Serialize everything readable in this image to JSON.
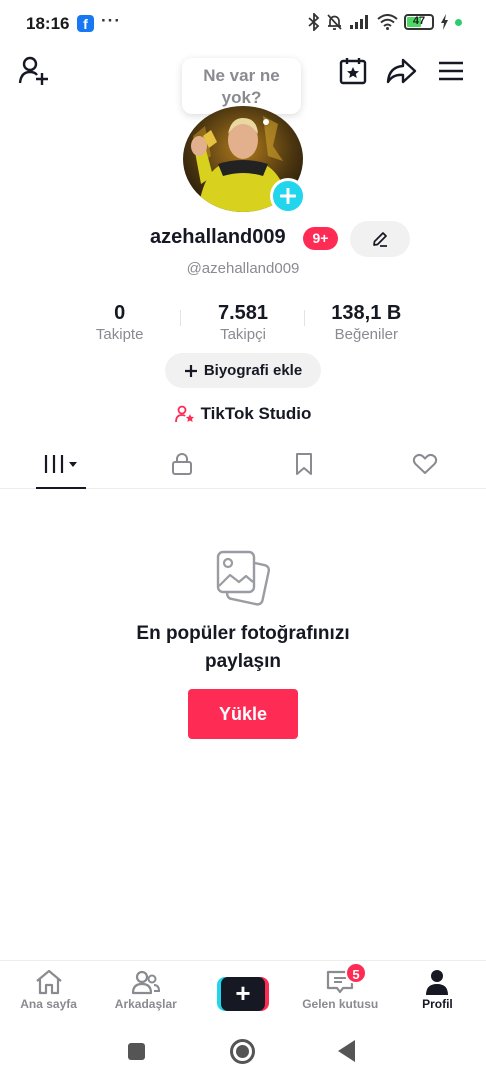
{
  "status_bar": {
    "time": "18:16",
    "notification_app": "f",
    "more": "···",
    "battery": "47"
  },
  "header": {
    "bubble_text": "Ne var ne yok?"
  },
  "profile": {
    "username": "azehalland009",
    "notification_badge": "9+",
    "handle": "@azehalland009",
    "stats": [
      {
        "value": "0",
        "label": "Takipte"
      },
      {
        "value": "7.581",
        "label": "Takipçi"
      },
      {
        "value": "138,1 B",
        "label": "Beğeniler"
      }
    ],
    "bio_button": "Biyografi ekle",
    "studio_label": "TikTok Studio"
  },
  "tabs": [
    {
      "icon": "grid-icon",
      "active": true
    },
    {
      "icon": "lock-icon",
      "active": false
    },
    {
      "icon": "bookmark-icon",
      "active": false
    },
    {
      "icon": "heart-icon",
      "active": false
    }
  ],
  "empty_state": {
    "title": "En popüler fotoğrafınızı paylaşın",
    "button": "Yükle"
  },
  "bottom_nav": {
    "home": "Ana sayfa",
    "friends": "Arkadaşlar",
    "create": "+",
    "inbox": "Gelen kutusu",
    "inbox_badge": "5",
    "profile": "Profil"
  },
  "colors": {
    "accent": "#fe2c55",
    "cyan": "#20d5ec",
    "text": "#161823",
    "muted": "#8a8b91"
  }
}
